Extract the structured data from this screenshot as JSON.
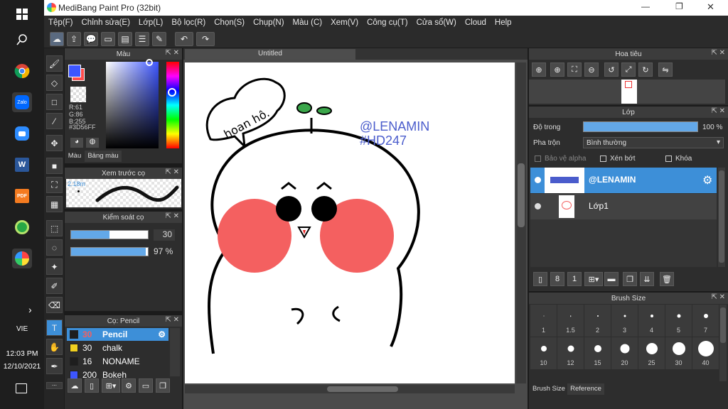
{
  "taskbar": {
    "time": "12:03 PM",
    "date": "12/10/2021",
    "lang": "VIE"
  },
  "window": {
    "title": "MediBang Paint Pro (32bit)",
    "minimize": "—",
    "maximize": "❐",
    "close": "✕"
  },
  "menu": [
    "Tệp(F)",
    "Chỉnh sửa(E)",
    "Lớp(L)",
    "Bộ lọc(R)",
    "Chọn(S)",
    "Chụp(N)",
    "Màu (C)",
    "Xem(V)",
    "Công cụ(T)",
    "Cửa sổ(W)",
    "Cloud",
    "Help"
  ],
  "color_panel": {
    "title": "Màu",
    "r": "R:61",
    "g": "G:86",
    "b": "B:255",
    "hex": "#3D56FF",
    "tab1": "Màu",
    "tab2": "Bảng màu",
    "primary": "#3d56ff",
    "secondary": "#ff4d4d"
  },
  "brush_preview": {
    "title": "Xem trước cọ",
    "size": "2.18m"
  },
  "brush_control": {
    "title": "Kiểm soát cọ",
    "size_value": "30",
    "size_fraction": 0.5,
    "opacity_value": "97 %",
    "opacity_fraction": 0.97
  },
  "brush_list": {
    "title": "Cọ: Pencil",
    "items": [
      {
        "size": "30",
        "name": "Pencil",
        "color": "#1e1e1e"
      },
      {
        "size": "30",
        "name": "chalk",
        "color": "#f0d020"
      },
      {
        "size": "16",
        "name": "NONAME",
        "color": "#1e1e1e"
      },
      {
        "size": "200",
        "name": "Bokeh",
        "color": "#3d56ff"
      }
    ]
  },
  "canvas": {
    "tab": "Untitled",
    "speech_text": "hoan hô.",
    "watermark_line1": "@LENAMIN",
    "watermark_line2": "#HD247"
  },
  "navigator": {
    "title": "Hoa tiêu"
  },
  "layers": {
    "title": "Lớp",
    "opacity_label": "Độ trong",
    "opacity_value": "100 %",
    "blend_label": "Pha trộn",
    "blend_value": "Bình thường",
    "protect_alpha": "Bảo vệ alpha",
    "clipping": "Xén bớt",
    "lock": "Khóa",
    "items": [
      {
        "name": "@LENAMIN"
      },
      {
        "name": "Lớp1"
      }
    ]
  },
  "brush_size": {
    "title": "Brush Size",
    "tab1": "Brush Size",
    "tab2": "Reference",
    "sizes": [
      "1",
      "1.5",
      "2",
      "3",
      "4",
      "5",
      "7",
      "10",
      "12",
      "15",
      "20",
      "25",
      "30",
      "40"
    ]
  }
}
